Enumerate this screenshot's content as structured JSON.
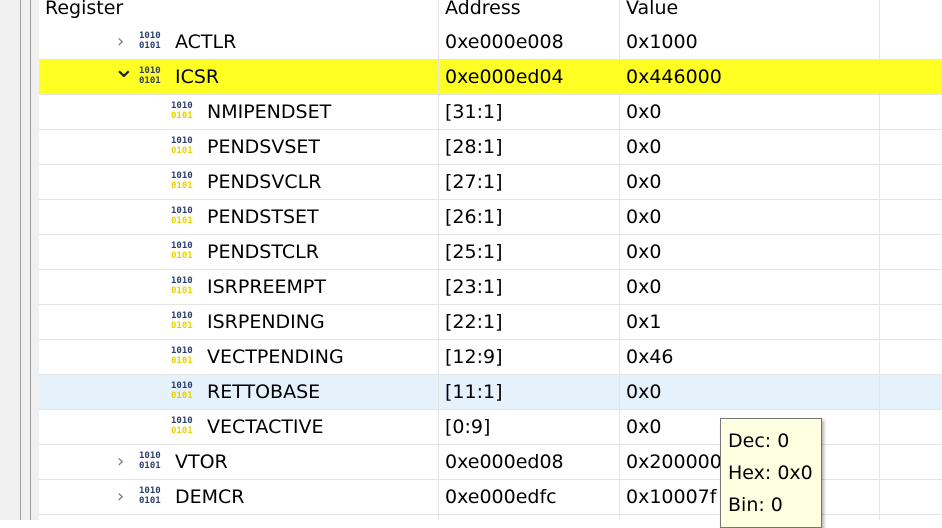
{
  "columns": [
    "Register",
    "Address",
    "Value"
  ],
  "rows": [
    {
      "name": "ACTLR",
      "address": "0xe000e008",
      "value": "0x1000",
      "level": 0,
      "state": "collapsed",
      "type": "register"
    },
    {
      "name": "ICSR",
      "address": "0xe000ed04",
      "value": "0x446000",
      "level": 0,
      "state": "expanded",
      "type": "register",
      "selected": true
    },
    {
      "name": "NMIPENDSET",
      "address": "[31:1]",
      "value": "0x0",
      "level": 1,
      "type": "field"
    },
    {
      "name": "PENDSVSET",
      "address": "[28:1]",
      "value": "0x0",
      "level": 1,
      "type": "field"
    },
    {
      "name": "PENDSVCLR",
      "address": "[27:1]",
      "value": "0x0",
      "level": 1,
      "type": "field"
    },
    {
      "name": "PENDSTSET",
      "address": "[26:1]",
      "value": "0x0",
      "level": 1,
      "type": "field"
    },
    {
      "name": "PENDSTCLR",
      "address": "[25:1]",
      "value": "0x0",
      "level": 1,
      "type": "field"
    },
    {
      "name": "ISRPREEMPT",
      "address": "[23:1]",
      "value": "0x0",
      "level": 1,
      "type": "field"
    },
    {
      "name": "ISRPENDING",
      "address": "[22:1]",
      "value": "0x1",
      "level": 1,
      "type": "field"
    },
    {
      "name": "VECTPENDING",
      "address": "[12:9]",
      "value": "0x46",
      "level": 1,
      "type": "field"
    },
    {
      "name": "RETTOBASE",
      "address": "[11:1]",
      "value": "0x0",
      "level": 1,
      "type": "field",
      "hovered": true
    },
    {
      "name": "VECTACTIVE",
      "address": "[0:9]",
      "value": "0x0",
      "level": 1,
      "type": "field"
    },
    {
      "name": "VTOR",
      "address": "0xe000ed08",
      "value": "0x20000000",
      "level": 0,
      "state": "collapsed",
      "type": "register"
    },
    {
      "name": "DEMCR",
      "address": "0xe000edfc",
      "value": "0x10007f",
      "level": 0,
      "state": "collapsed",
      "type": "register"
    }
  ],
  "icon_text": [
    "1010",
    "0101"
  ],
  "tooltip": [
    "Dec: 0",
    "Hex: 0x0",
    "Bin: 0"
  ]
}
